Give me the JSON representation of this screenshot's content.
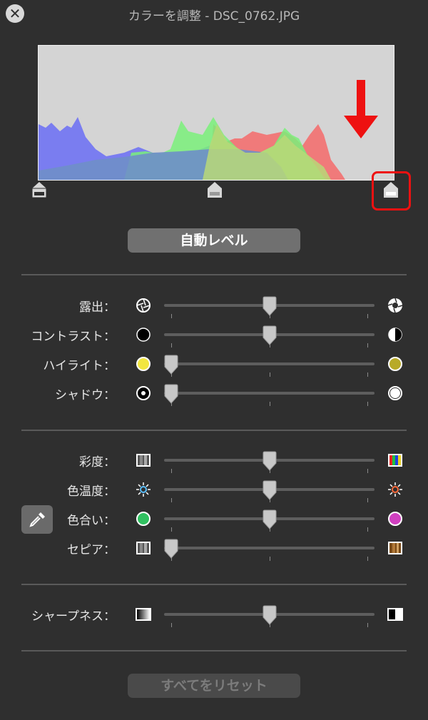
{
  "window": {
    "title": "カラーを調整 - DSC_0762.JPG",
    "close_glyph": "✕"
  },
  "histogram": {
    "channels": [
      "blue",
      "green",
      "red"
    ],
    "selected_marker": "white-point"
  },
  "auto_level_label": "自動レベル",
  "reset_all_label": "すべてをリセット",
  "groups": [
    {
      "rows": [
        {
          "label": "露出：",
          "value": 0.5,
          "left_icon": "aperture-closed-icon",
          "right_icon": "aperture-open-icon"
        },
        {
          "label": "コントラスト：",
          "value": 0.5,
          "left_icon": "filled-circle-icon",
          "right_icon": "half-circle-icon"
        },
        {
          "label": "ハイライト：",
          "value": 0.0,
          "left_icon": "yellow-circle-icon",
          "right_icon": "olive-circle-icon"
        },
        {
          "label": "シャドウ：",
          "value": 0.0,
          "left_icon": "dot-circle-icon",
          "right_icon": "white-circle-icon"
        }
      ]
    },
    {
      "rows": [
        {
          "label": "彩度：",
          "value": 0.5,
          "left_icon": "gray-swatch-icon",
          "right_icon": "color-swatch-icon"
        },
        {
          "label": "色温度：",
          "value": 0.5,
          "left_icon": "cool-sun-icon",
          "right_icon": "warm-sun-icon"
        },
        {
          "label": "色合い：",
          "value": 0.5,
          "left_icon": "green-circle-icon",
          "right_icon": "magenta-circle-icon"
        },
        {
          "label": "セピア：",
          "value": 0.0,
          "left_icon": "gray-swatch-icon",
          "right_icon": "sepia-swatch-icon"
        }
      ]
    },
    {
      "rows": [
        {
          "label": "シャープネス：",
          "value": 0.5,
          "left_icon": "soft-edge-icon",
          "right_icon": "sharp-edge-icon"
        }
      ]
    }
  ],
  "colors": {
    "background": "#2f2f2f",
    "accent_red": "#ee1111"
  }
}
